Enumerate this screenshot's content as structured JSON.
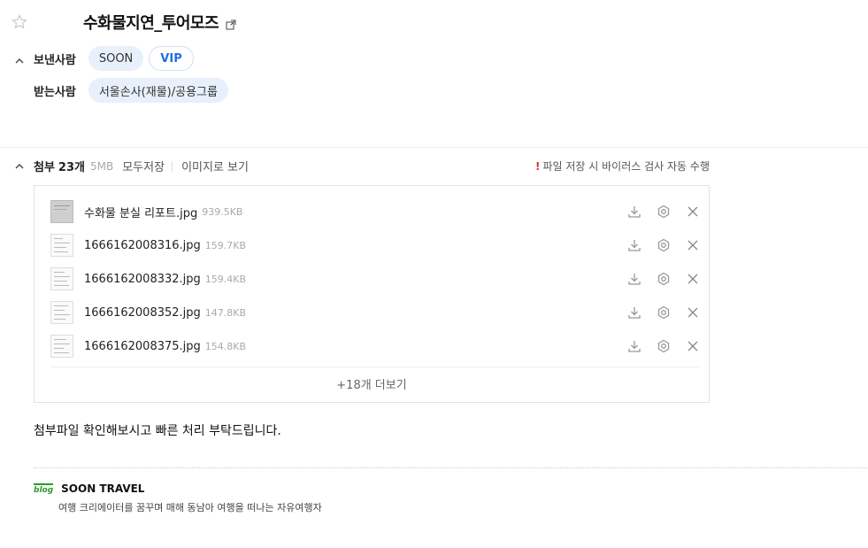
{
  "header": {
    "subject": "수화물지연_투어모즈"
  },
  "from": {
    "label": "보낸사람",
    "chips": [
      "SOON",
      "VIP"
    ]
  },
  "to": {
    "label": "받는사람",
    "chips": [
      "서울손사(재물)/공용그룹"
    ]
  },
  "attachments": {
    "title": "첨부",
    "count": "23개",
    "size": "5MB",
    "save_all": "모두저장",
    "view_images": "이미지로 보기",
    "notice": "파일 저장 시 바이러스 검사 자동 수행",
    "files": [
      {
        "name": "수화물 분실 리포트.jpg",
        "size": "939.5KB"
      },
      {
        "name": "1666162008316.jpg",
        "size": "159.7KB"
      },
      {
        "name": "1666162008332.jpg",
        "size": "159.4KB"
      },
      {
        "name": "1666162008352.jpg",
        "size": "147.8KB"
      },
      {
        "name": "1666162008375.jpg",
        "size": "154.8KB"
      }
    ],
    "more": "+18개 더보기"
  },
  "body": {
    "text": "첨부파일 확인해보시고 빠른 처리 부탁드립니다."
  },
  "signature": {
    "mark": "blog",
    "name": "SOON TRAVEL",
    "description": "여행 크리에이터를 꿈꾸며 매해 동남아 여행을 떠나는 자유여행자"
  },
  "colors": {
    "accent": "#1f6fe0",
    "chip_bg": "#e8f0fb",
    "blog_green": "#2a9c2a",
    "alert_red": "#e03030"
  },
  "icons": [
    "star-icon",
    "external-link-icon",
    "chevron-up-icon",
    "download-icon",
    "scan-icon",
    "close-icon"
  ]
}
